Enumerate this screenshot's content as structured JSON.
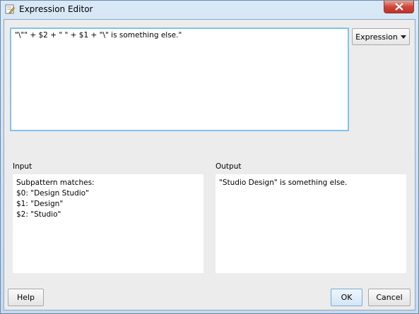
{
  "window": {
    "title": "Expression Editor"
  },
  "expression": {
    "value": "\"\\\"\" + $2 + \" \" + $1 + \"\\\" is something else.\"",
    "menu_button_label": "Expression"
  },
  "input": {
    "label": "Input",
    "lines": [
      "Subpattern matches:",
      "$0: \"Design Studio\"",
      "$1: \"Design\"",
      "$2: \"Studio\""
    ]
  },
  "output": {
    "label": "Output",
    "lines": [
      "\"Studio Design\" is something else."
    ]
  },
  "buttons": {
    "help": "Help",
    "ok": "OK",
    "cancel": "Cancel"
  }
}
